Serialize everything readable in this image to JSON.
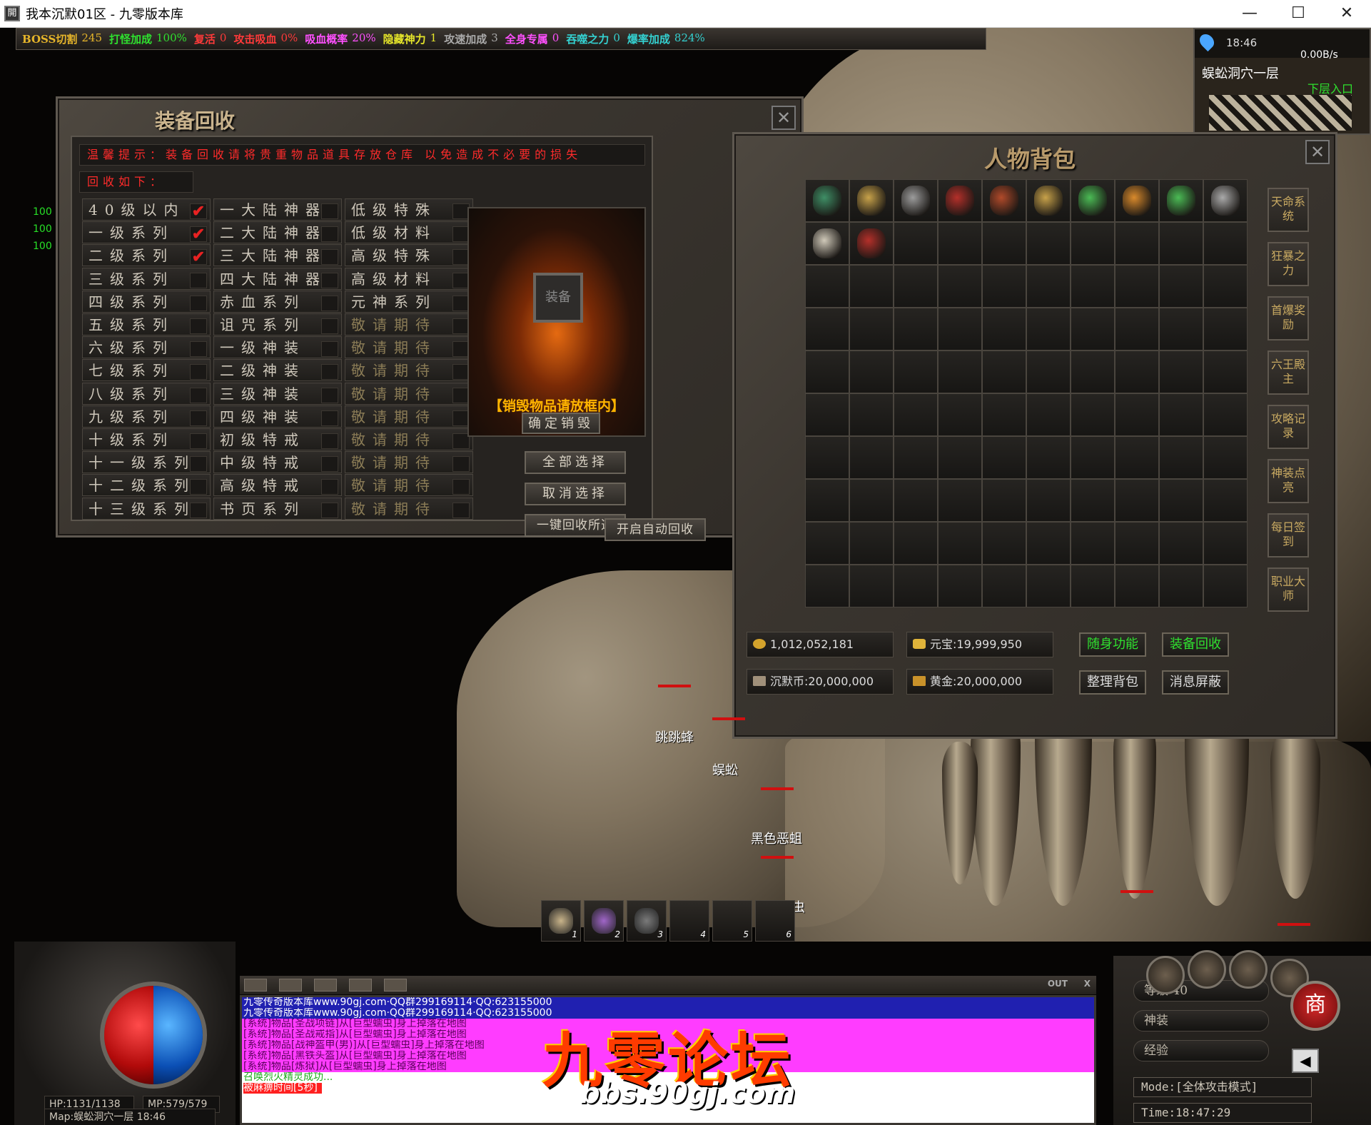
{
  "window": {
    "title": "我本沉默01区 - 九零版本库",
    "app_icon_text": "開"
  },
  "top_stats": [
    {
      "label": "BOSS切割",
      "value": "245",
      "color": "#e6b52a"
    },
    {
      "label": "打怪加成",
      "value": "100%",
      "color": "#2fe02f"
    },
    {
      "label": "复活",
      "value": "0",
      "color": "#ff3a3a"
    },
    {
      "label": "攻击吸血",
      "value": "0%",
      "color": "#ff3a3a"
    },
    {
      "label": "吸血概率",
      "value": "20%",
      "color": "#ff50ff"
    },
    {
      "label": "隐藏神力",
      "value": "1",
      "color": "#e6e62a"
    },
    {
      "label": "攻速加成",
      "value": "3",
      "color": "#aaaaaa"
    },
    {
      "label": "全身专属",
      "value": "0",
      "color": "#ff50ff"
    },
    {
      "label": "吞噬之力",
      "value": "0",
      "color": "#34d0d0"
    },
    {
      "label": "爆率加成",
      "value": "824%",
      "color": "#34d0d0"
    }
  ],
  "minimap": {
    "time": "18:46",
    "speed": "0.00B/s",
    "map_name": "蜈蚣洞穴一层",
    "exit_label": "下层入口"
  },
  "side_numbers": [
    "100",
    "100",
    "100"
  ],
  "recycle": {
    "title": "装备回收",
    "warning": "温馨提示：装备回收请将贵重物品道具存放仓库 以免造成不必要的损失",
    "subtitle": "回收如下：",
    "col1": [
      {
        "label": "40级以内",
        "checked": true
      },
      {
        "label": "一级系列",
        "checked": true
      },
      {
        "label": "二级系列",
        "checked": true
      },
      {
        "label": "三级系列",
        "checked": false
      },
      {
        "label": "四级系列",
        "checked": false
      },
      {
        "label": "五级系列",
        "checked": false
      },
      {
        "label": "六级系列",
        "checked": false
      },
      {
        "label": "七级系列",
        "checked": false
      },
      {
        "label": "八级系列",
        "checked": false
      },
      {
        "label": "九级系列",
        "checked": false
      },
      {
        "label": "十级系列",
        "checked": false
      },
      {
        "label": "十一级系列",
        "checked": false
      },
      {
        "label": "十二级系列",
        "checked": false
      },
      {
        "label": "十三级系列",
        "checked": false
      }
    ],
    "col2": [
      "一大陆神器",
      "二大陆神器",
      "三大陆神器",
      "四大陆神器",
      "赤血系列",
      "诅咒系列",
      "一级神装",
      "二级神装",
      "三级神装",
      "四级神装",
      "初级特戒",
      "中级特戒",
      "高级特戒",
      "书页系列"
    ],
    "col3": [
      "低级特殊",
      "低级材料",
      "高级特殊",
      "高级材料",
      "元神系列",
      "敬请期待",
      "敬请期待",
      "敬请期待",
      "敬请期待",
      "敬请期待",
      "敬请期待",
      "敬请期待",
      "敬请期待",
      "敬请期待"
    ],
    "altar_slot": "装备",
    "altar_tip": "【销毁物品请放框内】",
    "btn_destroy": "确定销毁",
    "btn_select_all": "全部选择",
    "btn_cancel": "取消选择",
    "btn_recycle": "一键回收所选",
    "btn_auto": "开启自动回收",
    "check_mark": "✔"
  },
  "bag": {
    "title": "人物背包",
    "side_buttons": [
      "天命系统",
      "狂暴之力",
      "首爆奖励",
      "六王殿主",
      "攻略记录",
      "神装点亮",
      "每日签到",
      "职业大师"
    ],
    "items": [
      {
        "slot": 0,
        "color": "#3f8f66"
      },
      {
        "slot": 1,
        "color": "#c8a24a"
      },
      {
        "slot": 2,
        "color": "#9c9c9c"
      },
      {
        "slot": 3,
        "color": "#b4302a"
      },
      {
        "slot": 4,
        "color": "#b14a2a"
      },
      {
        "slot": 5,
        "color": "#c8a24a"
      },
      {
        "slot": 6,
        "color": "#4bbb55"
      },
      {
        "slot": 7,
        "color": "#d98a2c"
      },
      {
        "slot": 8,
        "color": "#4bbb55"
      },
      {
        "slot": 9,
        "color": "#aaaaaa"
      },
      {
        "slot": 10,
        "color": "#d0c9b9"
      },
      {
        "slot": 11,
        "color": "#b4302a"
      }
    ],
    "gold": "1,012,052,181",
    "yuanbao": "元宝:19,999,950",
    "chenmo": "沉默币:20,000,000",
    "huangjin": "黄金:20,000,000",
    "btn_func": "随身功能",
    "btn_recycle": "装备回收",
    "btn_sort": "整理背包",
    "btn_mute": "消息屏蔽"
  },
  "mobs": [
    "跳跳蜂",
    "蜈蚣",
    "黑色恶蛆",
    "巨型蠕虫"
  ],
  "belt": [
    {
      "n": "1",
      "color": "#c9b48a"
    },
    {
      "n": "2",
      "color": "#a066c8"
    },
    {
      "n": "3",
      "color": "#7a7a7a"
    },
    {
      "n": "4",
      "color": ""
    },
    {
      "n": "5",
      "color": ""
    },
    {
      "n": "6",
      "color": ""
    }
  ],
  "status": {
    "hp": "HP:1131/1138",
    "mp": "MP:579/579",
    "map": "Map:蜈蚣洞穴一层 18:46"
  },
  "chat": {
    "lines": [
      "九零传奇版本库www.90gj.com·QQ群299169114·QQ:623155000",
      "九零传奇版本库www.90gj.com·QQ群299169114·QQ:623155000",
      "[系统]物品[圣战项链]从[巨型蠕虫]身上掉落在地图",
      "[系统]物品[圣战戒指]从[巨型蠕虫]身上掉落在地图",
      "[系统]物品[战神盔甲(男)]从[巨型蠕虫]身上掉落在地图",
      "[系统]物品[黑铁头盔]从[巨型蠕虫]身上掉落在地图",
      "[系统]物品[炼狱]从[巨型蠕虫]身上掉落在地图",
      "召唤烈火精灵成功...",
      "被麻痹时间[5秒]"
    ],
    "tools": [
      "OUT",
      "X"
    ]
  },
  "watermark": {
    "main": "九零论坛",
    "url": "bbs.90gj.com"
  },
  "right": {
    "level": "等级  40",
    "shenzhuang": "神装",
    "exp": "经验",
    "mode": "Mode:[全体攻击模式]",
    "time": "Time:18:47:29",
    "shop": "商"
  },
  "window_buttons": [
    "—",
    "☐",
    "✕"
  ]
}
